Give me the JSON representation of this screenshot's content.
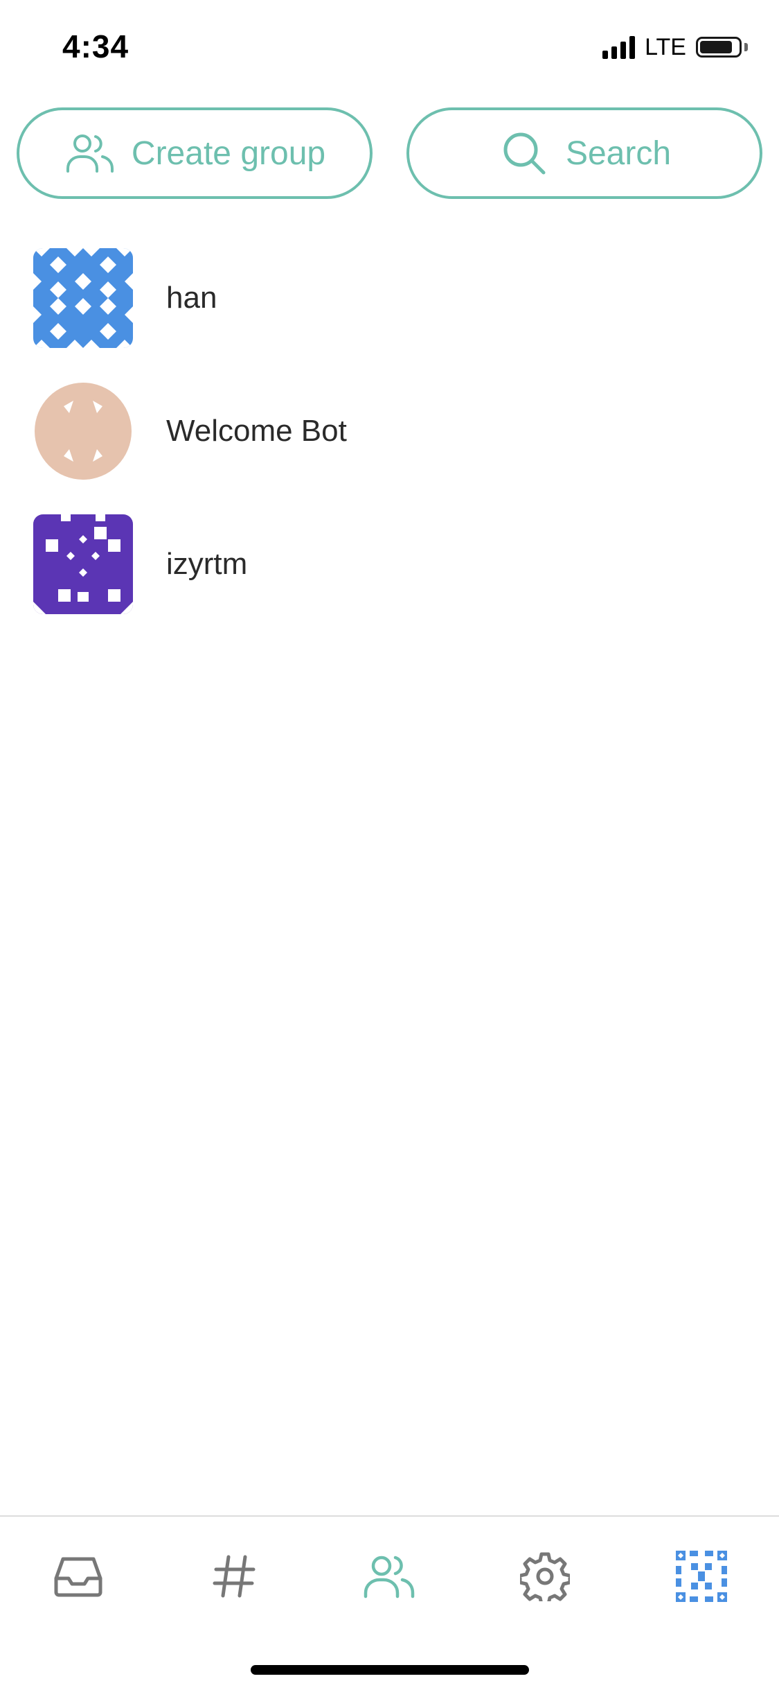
{
  "status_bar": {
    "time": "4:34",
    "network": "LTE",
    "battery_level_pct": 85,
    "signal_bars": 4
  },
  "actions": {
    "create_group_label": "Create group",
    "search_label": "Search",
    "accent_color": "#6dbfae"
  },
  "contacts": [
    {
      "name": "han",
      "avatar_color": "#4a90e2",
      "avatar_icon": "identicon-star-pattern"
    },
    {
      "name": "Welcome Bot",
      "avatar_color": "#e6c3ae",
      "avatar_icon": "identicon-ring-pattern"
    },
    {
      "name": "izyrtm",
      "avatar_color": "#5b35b4",
      "avatar_icon": "identicon-dots-pattern"
    }
  ],
  "tabbar": {
    "tabs": [
      {
        "icon": "inbox-icon",
        "active": false
      },
      {
        "icon": "hash-icon",
        "active": false
      },
      {
        "icon": "people-icon",
        "active": true
      },
      {
        "icon": "gear-icon",
        "active": false
      },
      {
        "icon": "profile-avatar-icon",
        "active": false
      }
    ],
    "active_color": "#6dbfae",
    "inactive_color": "#777777"
  }
}
